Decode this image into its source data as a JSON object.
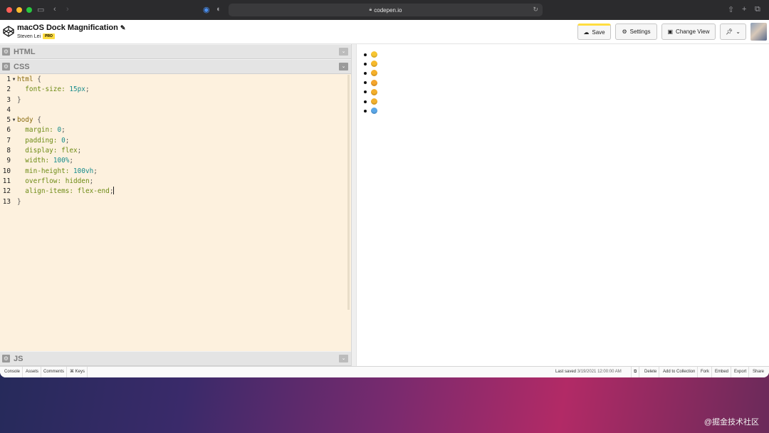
{
  "browser": {
    "url": "codepen.io"
  },
  "pen": {
    "title": "macOS Dock Magnification",
    "author": "Steven Lei",
    "badge": "PRO"
  },
  "header_buttons": {
    "save": "Save",
    "settings": "Settings",
    "change_view": "Change View"
  },
  "panes": {
    "html": "HTML",
    "css": "CSS",
    "js": "JS"
  },
  "code_lines": [
    {
      "n": "1",
      "fold": true,
      "tokens": [
        {
          "c": "sel",
          "t": "html"
        },
        {
          "c": "pn",
          "t": " {"
        }
      ]
    },
    {
      "n": "2",
      "fold": false,
      "tokens": [
        {
          "c": "prop",
          "t": "  font-size: "
        },
        {
          "c": "val",
          "t": "15px"
        },
        {
          "c": "pn",
          "t": ";"
        }
      ]
    },
    {
      "n": "3",
      "fold": false,
      "tokens": [
        {
          "c": "pn",
          "t": "}"
        }
      ]
    },
    {
      "n": "4",
      "fold": false,
      "tokens": []
    },
    {
      "n": "5",
      "fold": true,
      "tokens": [
        {
          "c": "sel",
          "t": "body"
        },
        {
          "c": "pn",
          "t": " {"
        }
      ]
    },
    {
      "n": "6",
      "fold": false,
      "tokens": [
        {
          "c": "prop",
          "t": "  margin: "
        },
        {
          "c": "val",
          "t": "0"
        },
        {
          "c": "pn",
          "t": ";"
        }
      ]
    },
    {
      "n": "7",
      "fold": false,
      "tokens": [
        {
          "c": "prop",
          "t": "  padding: "
        },
        {
          "c": "val",
          "t": "0"
        },
        {
          "c": "pn",
          "t": ";"
        }
      ]
    },
    {
      "n": "8",
      "fold": false,
      "tokens": [
        {
          "c": "prop",
          "t": "  display: flex"
        },
        {
          "c": "pn",
          "t": ";"
        }
      ]
    },
    {
      "n": "9",
      "fold": false,
      "tokens": [
        {
          "c": "prop",
          "t": "  width: "
        },
        {
          "c": "val",
          "t": "100%"
        },
        {
          "c": "pn",
          "t": ";"
        }
      ]
    },
    {
      "n": "10",
      "fold": false,
      "tokens": [
        {
          "c": "prop",
          "t": "  min-height: "
        },
        {
          "c": "val",
          "t": "100vh"
        },
        {
          "c": "pn",
          "t": ";"
        }
      ]
    },
    {
      "n": "11",
      "fold": false,
      "tokens": [
        {
          "c": "prop",
          "t": "  overflow: hidden"
        },
        {
          "c": "pn",
          "t": ";"
        }
      ]
    },
    {
      "n": "12",
      "fold": false,
      "caret": true,
      "tokens": [
        {
          "c": "prop",
          "t": "  align-items: flex-end"
        },
        {
          "c": "pn",
          "t": ";"
        }
      ]
    },
    {
      "n": "13",
      "fold": false,
      "tokens": [
        {
          "c": "pn",
          "t": "}"
        }
      ]
    }
  ],
  "preview_emojis": [
    {
      "name": "grinning-face",
      "color": "#f7c531"
    },
    {
      "name": "smiling-face",
      "color": "#f6b92b"
    },
    {
      "name": "tongue-face",
      "color": "#f5b02a"
    },
    {
      "name": "heart-eyes-face",
      "color": "#f4a52c"
    },
    {
      "name": "star-struck-face",
      "color": "#f3ae2a"
    },
    {
      "name": "zany-face",
      "color": "#f2b12e"
    },
    {
      "name": "cold-face",
      "color": "#5aa7e8"
    }
  ],
  "footer": {
    "left": [
      "Console",
      "Assets",
      "Comments",
      "⌘ Keys"
    ],
    "saved_label": "Last saved",
    "saved_time": "3/19/2021 12:00:00 AM",
    "right": [
      "Delete",
      "Add to Collection",
      "Fork",
      "Embed",
      "Export",
      "Share"
    ]
  },
  "watermark": "@掘金技术社区"
}
